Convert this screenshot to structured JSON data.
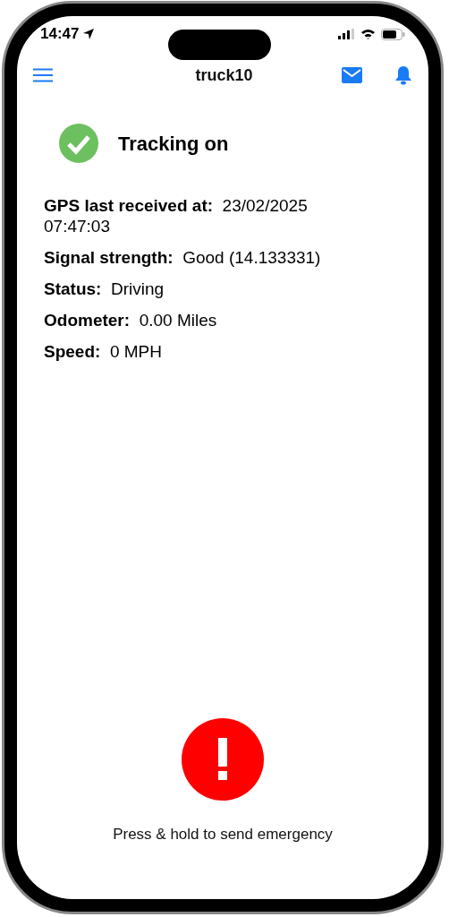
{
  "status_bar": {
    "time": "14:47"
  },
  "nav": {
    "title": "truck10"
  },
  "tracking": {
    "on": true,
    "label": "Tracking on"
  },
  "details": [
    {
      "label": "GPS last received at:",
      "value": "23/02/2025 07:47:03"
    },
    {
      "label": "Signal strength:",
      "value": "Good (14.133331)"
    },
    {
      "label": "Status:",
      "value": "Driving"
    },
    {
      "label": "Odometer:",
      "value": "0.00 Miles"
    },
    {
      "label": "Speed:",
      "value": "0 MPH"
    }
  ],
  "emergency": {
    "hint": "Press & hold to send emergency"
  }
}
